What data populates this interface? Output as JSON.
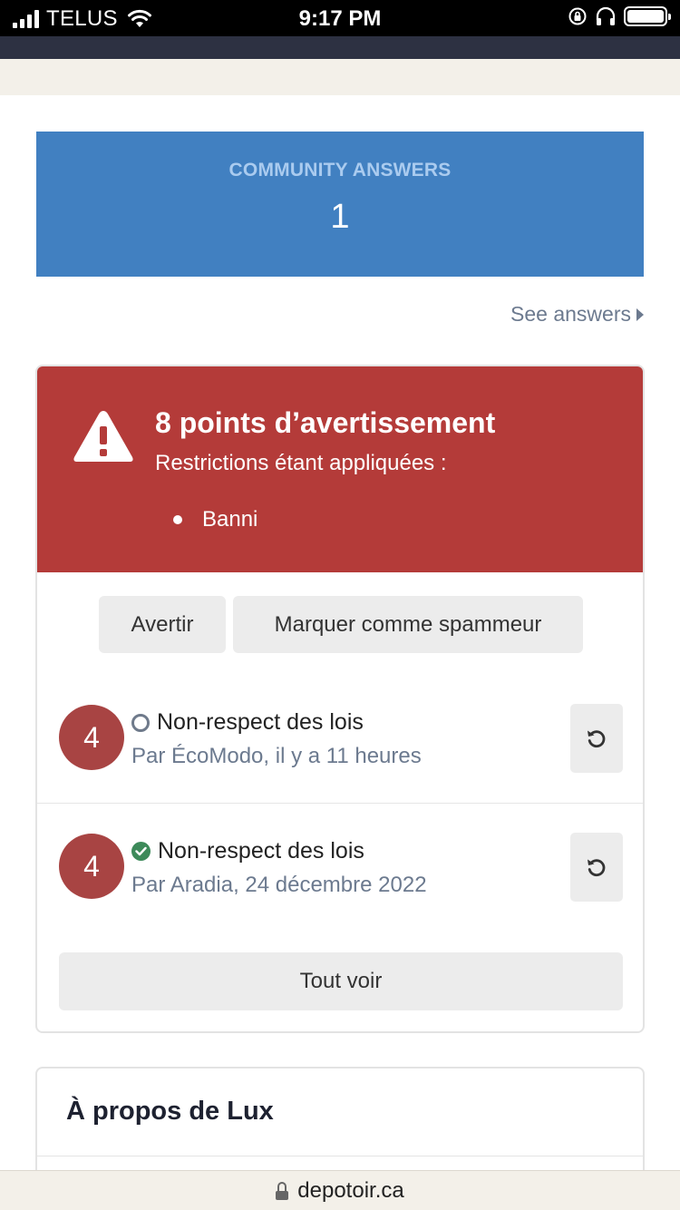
{
  "status_bar": {
    "carrier": "TELUS",
    "time": "9:17 PM"
  },
  "community_answers": {
    "title": "COMMUNITY ANSWERS",
    "count": "1",
    "link_label": "See answers"
  },
  "warning_panel": {
    "title": "8 points d’avertissement",
    "subtitle": "Restrictions étant appliquées :",
    "restrictions": [
      "Banni"
    ],
    "buttons": {
      "warn": "Avertir",
      "mark_spammer": "Marquer comme spammeur",
      "view_all": "Tout voir"
    },
    "warnings": [
      {
        "points": "4",
        "reason": "Non-respect des lois",
        "meta": "Par ÉcoModo, il y a 11 heures",
        "status": "pending"
      },
      {
        "points": "4",
        "reason": "Non-respect des lois",
        "meta": "Par Aradia, 24 décembre 2022",
        "status": "approved"
      }
    ]
  },
  "about": {
    "title": "À propos de Lux"
  },
  "browser": {
    "url": "depotoir.ca"
  },
  "colors": {
    "community_blue": "#4180c1",
    "warning_red": "#b43b39",
    "points_circle": "#a84443",
    "approved_green": "#3d8a5a"
  }
}
